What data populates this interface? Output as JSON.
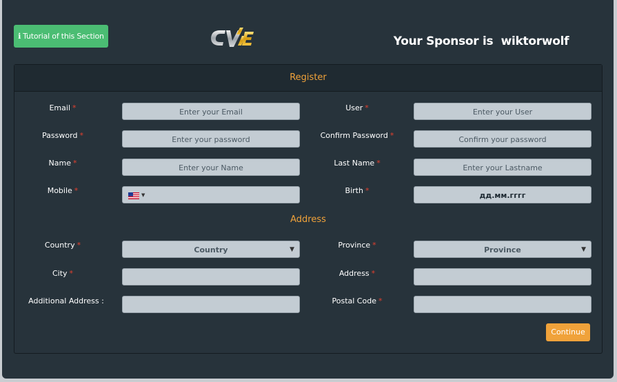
{
  "header": {
    "tutorial_label": "Tutorial of this Section",
    "logo_text": "CVIE",
    "sponsor_prefix": "Your Sponsor is",
    "sponsor_name": "wiktorwolf"
  },
  "panel_title": "Register",
  "required_marker": "*",
  "fields": {
    "email": {
      "label": "Email",
      "placeholder": "Enter your Email"
    },
    "user": {
      "label": "User",
      "placeholder": "Enter your User"
    },
    "password": {
      "label": "Password",
      "placeholder": "Enter your password"
    },
    "confirm_password": {
      "label": "Confirm Password",
      "placeholder": "Confirm your password"
    },
    "name": {
      "label": "Name",
      "placeholder": "Enter your Name"
    },
    "last_name": {
      "label": "Last Name",
      "placeholder": "Enter your Lastname"
    },
    "mobile": {
      "label": "Mobile",
      "value": ""
    },
    "birth": {
      "label": "Birth",
      "placeholder": "дд.мм.гггг"
    }
  },
  "address_title": "Address",
  "address_fields": {
    "country": {
      "label": "Country",
      "selected": "Country"
    },
    "province": {
      "label": "Province",
      "selected": "Province"
    },
    "city": {
      "label": "City",
      "value": ""
    },
    "address": {
      "label": "Address",
      "value": ""
    },
    "additional_address": {
      "label": "Additional Address :",
      "value": ""
    },
    "postal_code": {
      "label": "Postal Code",
      "value": ""
    }
  },
  "continue_label": "Continue",
  "colors": {
    "background": "#27333b",
    "accent": "#f0a23a",
    "tutorial_green": "#4bbd73",
    "required_red": "#e2402f",
    "input_bg": "#c3ccd3"
  }
}
